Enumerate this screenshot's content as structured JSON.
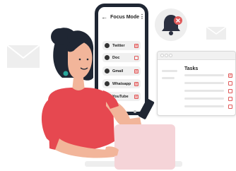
{
  "phone": {
    "back_icon": "arrow-left-icon",
    "title": "Focus Mode",
    "menu_icon": "kebab-icon",
    "apps": [
      {
        "label": "Twitter",
        "icon": "twitter-icon",
        "checked": true
      },
      {
        "label": "Doc",
        "icon": "document-icon",
        "checked": false
      },
      {
        "label": "Gmail",
        "icon": "gmail-icon",
        "checked": true
      },
      {
        "label": "Whatsapp",
        "icon": "whatsapp-icon",
        "checked": true
      },
      {
        "label": "YouTube",
        "icon": "youtube-icon",
        "checked": true
      }
    ]
  },
  "notification": {
    "icon": "bell-muted-icon",
    "badge_icon": "close-icon",
    "bell_color": "#2b3040",
    "badge_color": "#e05a5a"
  },
  "tasks_window": {
    "title": "Tasks",
    "items": [
      {
        "checked": true
      },
      {
        "checked": false
      },
      {
        "checked": false
      },
      {
        "checked": false
      },
      {
        "checked": false
      }
    ]
  },
  "colors": {
    "accent": "#e05a5a",
    "dark": "#1f2633",
    "shirt": "#e64850",
    "laptop": "#f5d4d8",
    "skin": "#f2b59a"
  }
}
